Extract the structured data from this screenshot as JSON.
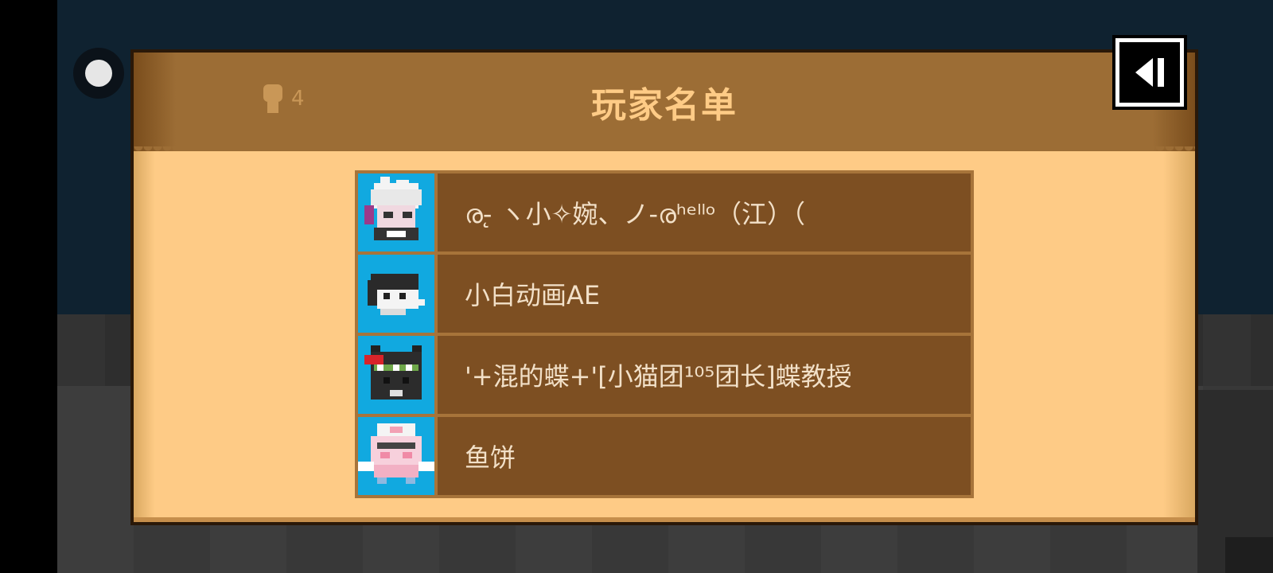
{
  "header": {
    "title": "玩家名单",
    "player_count": "4"
  },
  "players": [
    {
      "name": "ര-̨ ヽ小✧婉、ノ-രʰᵉˡˡᵒ（江）（",
      "avatar_icon": "pixel-avatar-white-hair-girl"
    },
    {
      "name": "小白动画AE",
      "avatar_icon": "pixel-avatar-ghost-mask"
    },
    {
      "name": "'+混的蝶+'[小猫团¹⁰⁵团长]蝶教授",
      "avatar_icon": "pixel-avatar-dark-cat"
    },
    {
      "name": "鱼饼",
      "avatar_icon": "pixel-avatar-pink-bunny"
    }
  ],
  "colors": {
    "panel_header": "#9c6d35",
    "panel_body": "#fecb86",
    "title_text": "#fecb86",
    "row_background": "#7d4f22",
    "avatar_background": "#11a9e0",
    "name_text": "#f2e0c8"
  }
}
